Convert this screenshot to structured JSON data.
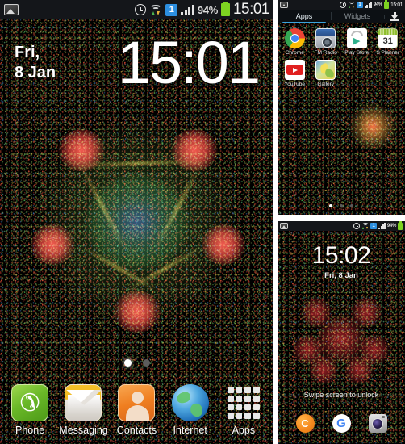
{
  "home": {
    "statusbar": {
      "gallery_icon": "gallery-icon",
      "alarm_icon": "alarm-icon",
      "wifi_icon": "wifi-transfer-icon",
      "badge": "1",
      "signal_icon": "signal-bars-icon",
      "battery_percent": "94%",
      "battery_icon": "battery-icon",
      "clock": "15:01"
    },
    "clock_widget": {
      "day": "Fri,",
      "date": "8 Jan",
      "time": "15:01"
    },
    "page_dots": {
      "count": 2,
      "active": 0
    },
    "dock": [
      {
        "label": "Phone",
        "icon": "phone-icon"
      },
      {
        "label": "Messaging",
        "icon": "messaging-icon"
      },
      {
        "label": "Contacts",
        "icon": "contacts-icon"
      },
      {
        "label": "Internet",
        "icon": "internet-icon"
      },
      {
        "label": "Apps",
        "icon": "apps-grid-icon"
      }
    ]
  },
  "drawer": {
    "statusbar": {
      "battery_percent": "94%",
      "badge": "1",
      "clock": "15:01"
    },
    "tabs": [
      {
        "label": "Apps",
        "active": true
      },
      {
        "label": "Widgets",
        "active": false
      }
    ],
    "download_icon": "download-icon",
    "apps": [
      {
        "label": "Chrome",
        "icon": "chrome-icon"
      },
      {
        "label": "FM Radio",
        "icon": "fm-radio-icon"
      },
      {
        "label": "Play Store",
        "icon": "play-store-icon"
      },
      {
        "label": "S Planner",
        "icon": "s-planner-icon",
        "day": "31"
      },
      {
        "label": "YouTube",
        "icon": "youtube-icon"
      },
      {
        "label": "Gallery",
        "icon": "gallery-app-icon"
      }
    ],
    "page_dots": {
      "count": 3,
      "active": 0
    }
  },
  "lock": {
    "statusbar": {
      "battery_percent": "94%",
      "badge": "1"
    },
    "time": "15:02",
    "date": "Fri, 8 Jan",
    "unlock_hint": "Swipe screen to unlock",
    "shortcuts": [
      {
        "name": "chaton-icon",
        "glyph": "C"
      },
      {
        "name": "google-icon",
        "glyph": "G"
      },
      {
        "name": "camera-icon",
        "glyph": ""
      }
    ]
  },
  "theme": {
    "accent": "#3aa3dd",
    "battery": "#7ed321",
    "badge": "#2c8fe0",
    "wallpaper_bg": "#000000",
    "node_red": "#ff5a50",
    "edge_gold": "#c8af3c",
    "core_blue": "#3c5ac8"
  }
}
